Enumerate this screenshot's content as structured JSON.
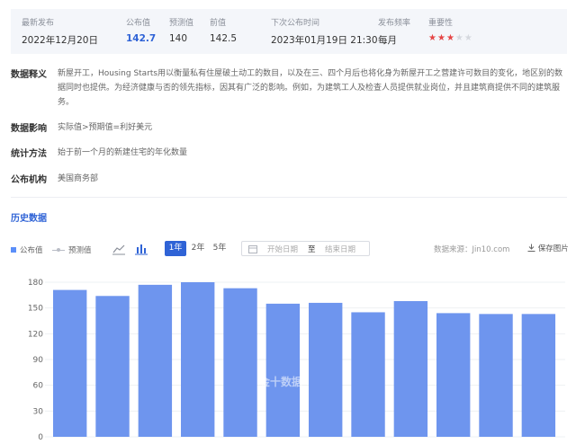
{
  "summary": {
    "latest_release": {
      "label": "最新发布",
      "value": "2022年12月20日"
    },
    "actual": {
      "label": "公布值",
      "value": "142.7"
    },
    "forecast": {
      "label": "预测值",
      "value": "140"
    },
    "previous": {
      "label": "前值",
      "value": "142.5"
    },
    "next_release": {
      "label": "下次公布时间",
      "value": "2023年01月19日 21:30"
    },
    "frequency": {
      "label": "发布频率",
      "value": "每月"
    },
    "importance": {
      "label": "重要性",
      "stars": 3,
      "max_stars": 5
    }
  },
  "details": [
    {
      "key": "数据释义",
      "text": "新屋开工，Housing Starts用以衡量私有住屋破土动工的数目，以及在三、四个月后也将化身为新屋开工之营建许可数目的变化，地区别的数据同时也提供。为经济健康与否的领先指标，因其有广泛的影响。例如，为建筑工人及检查人员提供就业岗位，并且建筑商提供不同的建筑服务。"
    },
    {
      "key": "数据影响",
      "text": "实际值>预期值=利好美元"
    },
    {
      "key": "统计方法",
      "text": "始于前一个月的新建住宅的年化数量"
    },
    {
      "key": "公布机构",
      "text": "美国商务部"
    }
  ],
  "history": {
    "title": "历史数据",
    "legend_actual": "公布值",
    "legend_forecast": "预测值",
    "ranges": [
      "1年",
      "2年",
      "5年"
    ],
    "active_range": "1年",
    "start_placeholder": "开始日期",
    "to_label": "至",
    "end_placeholder": "结束日期",
    "source": "数据来源：Jin10.com",
    "save": "保存图片",
    "watermark": "金十数据"
  },
  "colors": {
    "accent": "#2f63d6",
    "bar": "#6e95ee",
    "star": "#e54545"
  },
  "chart_data": {
    "type": "bar",
    "y_ticks": [
      "180",
      "150",
      "120",
      "90",
      "60",
      "30",
      "0"
    ],
    "ylim": [
      0,
      180
    ],
    "values": [
      171,
      164,
      177,
      180,
      173,
      155,
      156,
      145,
      158,
      144,
      143,
      143
    ],
    "grid": true
  }
}
